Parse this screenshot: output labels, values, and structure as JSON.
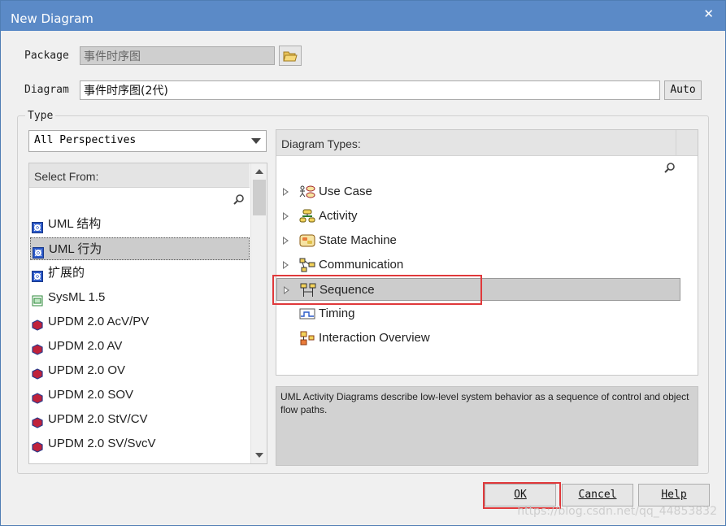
{
  "window": {
    "title": "New Diagram",
    "close_glyph": "✕"
  },
  "package": {
    "label": "Package",
    "value": "事件时序图",
    "browse_icon": "folder-open-icon"
  },
  "diagram": {
    "label": "Diagram",
    "value": "事件时序图(2代)",
    "auto_button": "Auto"
  },
  "type_group": {
    "label": "Type"
  },
  "perspective": {
    "selected": "All Perspectives"
  },
  "select_from": {
    "header": "Select From:",
    "items": [
      {
        "label": "UML 结构",
        "icon": "uml-package-icon",
        "selected": false
      },
      {
        "label": "UML 行为",
        "icon": "uml-package-icon",
        "selected": true
      },
      {
        "label": "扩展的",
        "icon": "uml-package-icon",
        "selected": false
      },
      {
        "label": "SysML 1.5",
        "icon": "sysml-icon",
        "selected": false
      },
      {
        "label": "UPDM 2.0 AcV/PV",
        "icon": "updm-icon",
        "selected": false
      },
      {
        "label": "UPDM 2.0 AV",
        "icon": "updm-icon",
        "selected": false
      },
      {
        "label": "UPDM 2.0 OV",
        "icon": "updm-icon",
        "selected": false
      },
      {
        "label": "UPDM 2.0 SOV",
        "icon": "updm-icon",
        "selected": false
      },
      {
        "label": "UPDM 2.0 StV/CV",
        "icon": "updm-icon",
        "selected": false
      },
      {
        "label": "UPDM 2.0 SV/SvcV",
        "icon": "updm-icon",
        "selected": false
      }
    ]
  },
  "diagram_types": {
    "header": "Diagram Types:",
    "items": [
      {
        "label": "Use Case",
        "icon": "use-case-icon",
        "expandable": true
      },
      {
        "label": "Activity",
        "icon": "activity-icon",
        "expandable": true
      },
      {
        "label": "State Machine",
        "icon": "state-machine-icon",
        "expandable": true
      },
      {
        "label": "Communication",
        "icon": "communication-icon",
        "expandable": true
      },
      {
        "label": "Sequence",
        "icon": "sequence-icon",
        "expandable": true,
        "selected": true
      },
      {
        "label": "Timing",
        "icon": "timing-icon",
        "expandable": false
      },
      {
        "label": "Interaction Overview",
        "icon": "interaction-overview-icon",
        "expandable": false
      }
    ]
  },
  "description": "UML Activity Diagrams describe low-level system behavior as a sequence of control and object flow paths.",
  "buttons": {
    "ok": "OK",
    "cancel": "Cancel",
    "help": "Help"
  },
  "watermark": "https://blog.csdn.net/qq_44853832",
  "colors": {
    "titlebar": "#5b8ac7",
    "selection": "#cccccc",
    "highlight_box": "#e0393b"
  }
}
